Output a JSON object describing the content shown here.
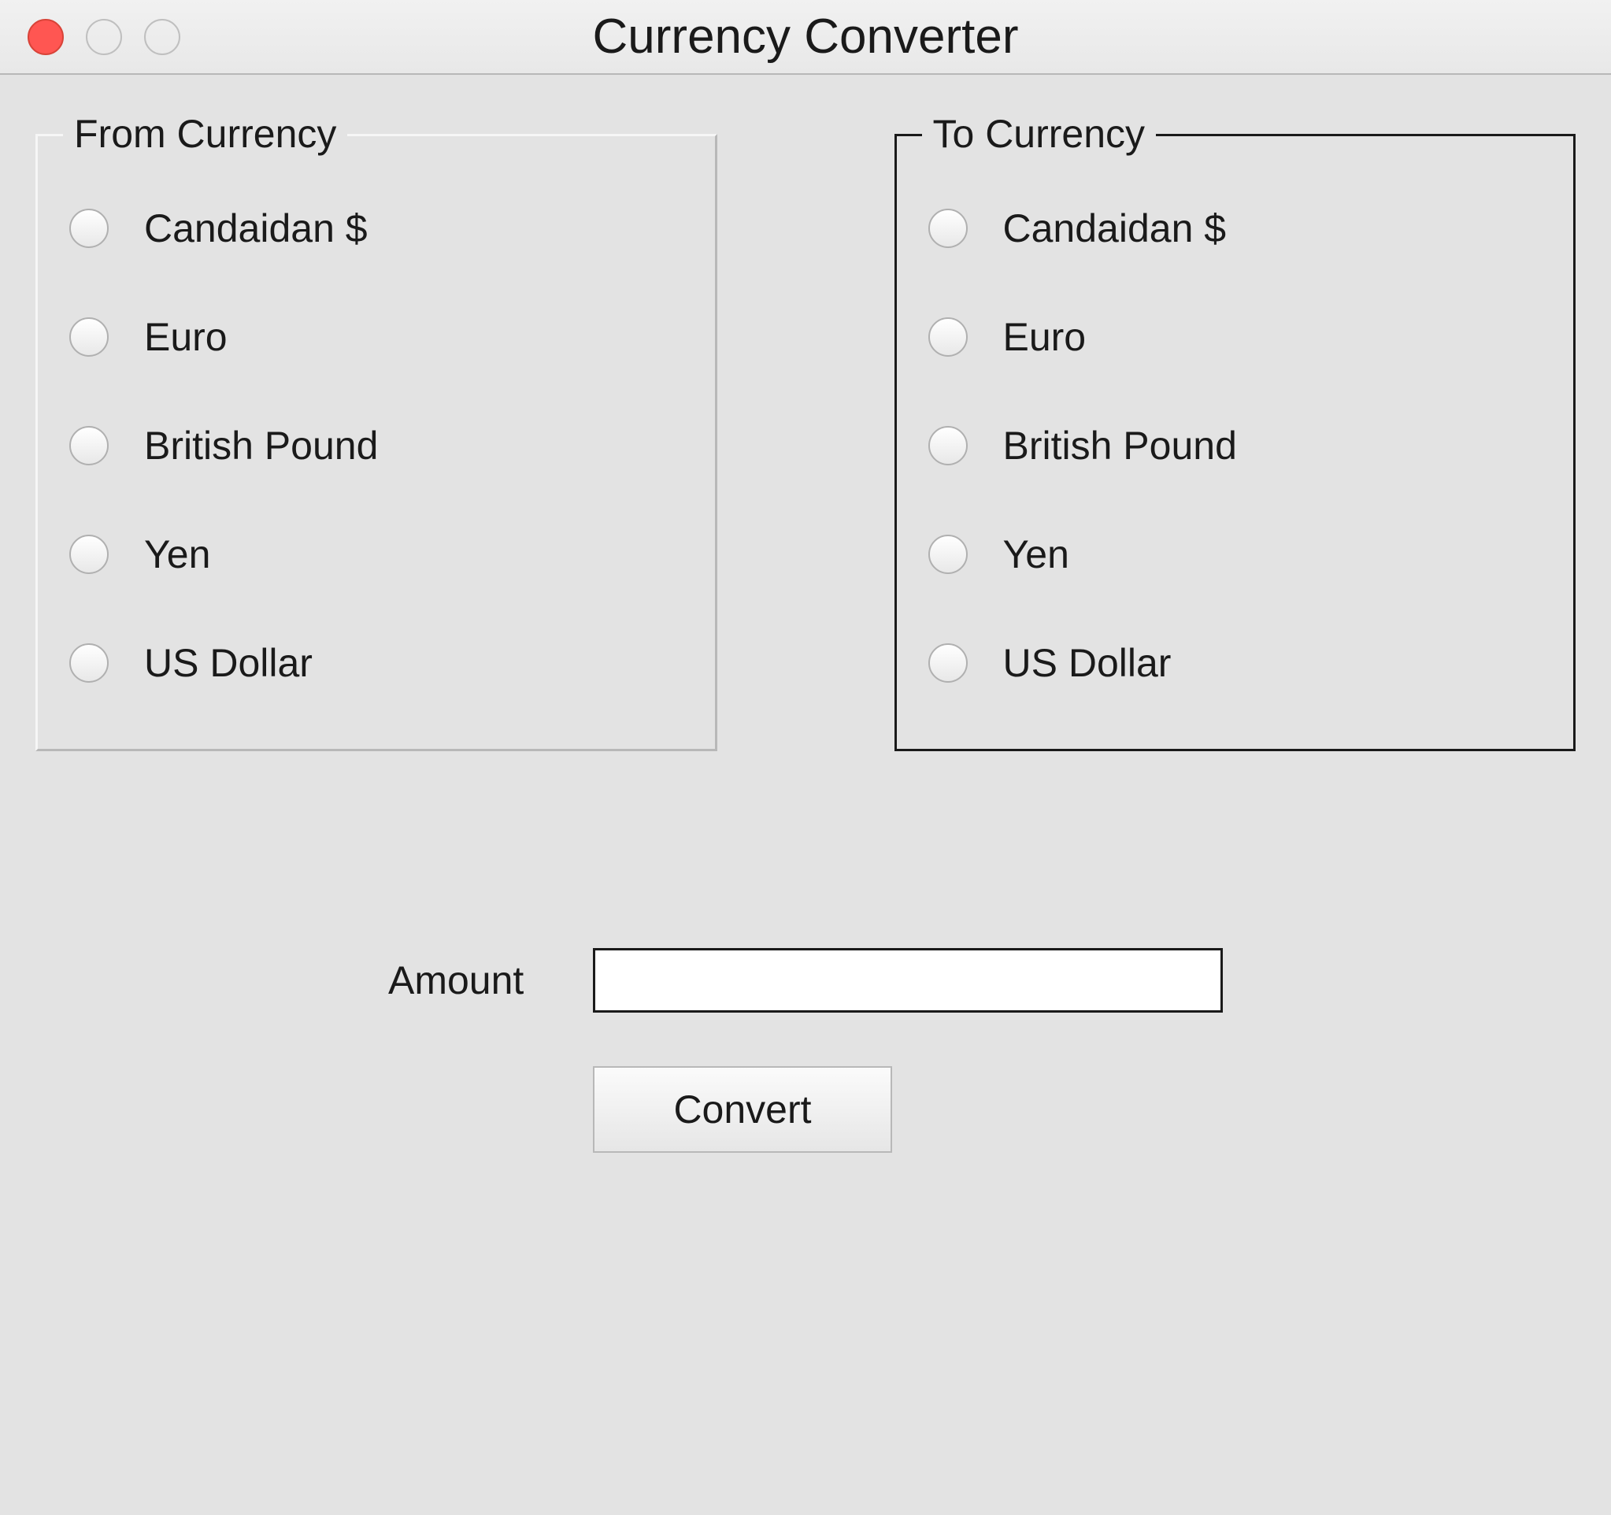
{
  "window": {
    "title": "Currency Converter"
  },
  "groups": {
    "from_label": "From Currency",
    "to_label": "To Currency"
  },
  "currencies": {
    "from": [
      {
        "label": "Candaidan $"
      },
      {
        "label": "Euro"
      },
      {
        "label": "British Pound"
      },
      {
        "label": "Yen"
      },
      {
        "label": "US Dollar"
      }
    ],
    "to": [
      {
        "label": "Candaidan $"
      },
      {
        "label": "Euro"
      },
      {
        "label": "British Pound"
      },
      {
        "label": "Yen"
      },
      {
        "label": "US Dollar"
      }
    ]
  },
  "form": {
    "amount_label": "Amount",
    "amount_value": "",
    "convert_label": "Convert"
  }
}
